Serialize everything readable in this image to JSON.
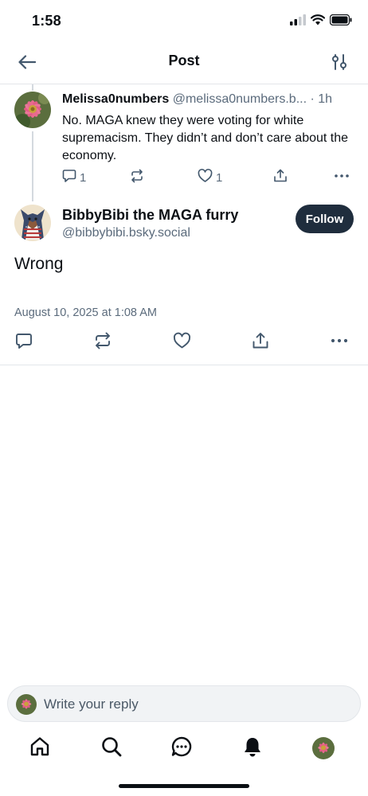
{
  "status_bar": {
    "time": "1:58"
  },
  "header": {
    "title": "Post"
  },
  "parent_post": {
    "author_name": "Melissa0numbers",
    "author_handle": "@melissa0numbers.b...",
    "separator": "·",
    "age": "1h",
    "text": "No. MAGA knew they were voting for white supremacism. They didn’t and don’t care about the economy.",
    "reply_count": "1",
    "like_count": "1"
  },
  "main_post": {
    "author_name": "BibbyBibi the MAGA furry",
    "author_handle": "@bibbybibi.bsky.social",
    "follow_label": "Follow",
    "text": "Wrong",
    "timestamp": "August 10, 2025 at 1:08 AM"
  },
  "composer": {
    "placeholder": "Write your reply"
  },
  "colors": {
    "accent": "#1f2d3d",
    "icon_gray": "#5b6b7c",
    "action_blue": "#42576c",
    "divider": "#e3e6ea"
  },
  "icons": {
    "header": [
      "back-arrow-icon",
      "filter-sliders-icon"
    ],
    "post_actions": [
      "reply-icon",
      "repost-icon",
      "like-icon",
      "share-icon",
      "more-icon"
    ],
    "nav": [
      "home-icon",
      "search-icon",
      "chat-icon",
      "bell-icon",
      "profile-avatar"
    ]
  }
}
